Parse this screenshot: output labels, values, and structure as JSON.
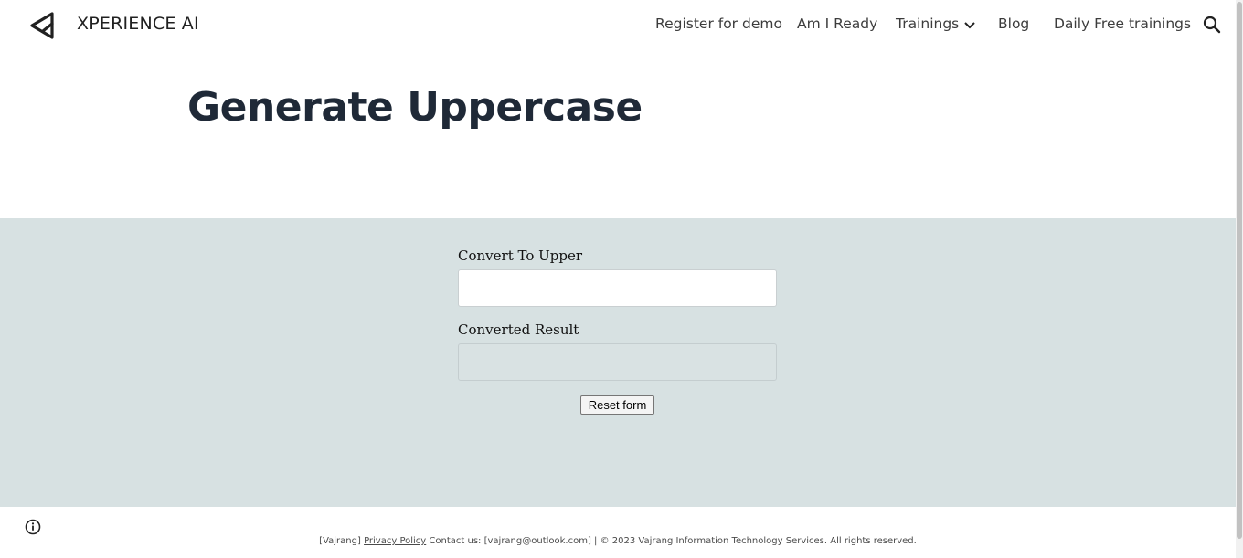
{
  "header": {
    "site_title": "XPERIENCE AI",
    "nav": [
      {
        "label": "Register for demo"
      },
      {
        "label": "Am I Ready"
      },
      {
        "label": "Trainings"
      },
      {
        "label": "Blog"
      },
      {
        "label": "Daily Free trainings"
      }
    ],
    "icons": {
      "logo": "arrow-logo-icon",
      "search": "search-icon",
      "dropdown": "chevron-down-icon"
    }
  },
  "main": {
    "title": "Generate Uppercase"
  },
  "form": {
    "input_label": "Convert To Upper",
    "input_value": "",
    "result_label": "Converted Result",
    "result_value": "",
    "reset_label": "Reset form"
  },
  "footer": {
    "prefix": "[Vajrang]",
    "privacy_link": "Privacy Policy",
    "contact": "Contact us: [vajrang@outlook.com] | © 2023 Vajrang Information Technology Services. All rights reserved.",
    "info_icon": "info-icon"
  },
  "colors": {
    "form_background": "#d7e1e2",
    "title_color": "#1f2937"
  }
}
